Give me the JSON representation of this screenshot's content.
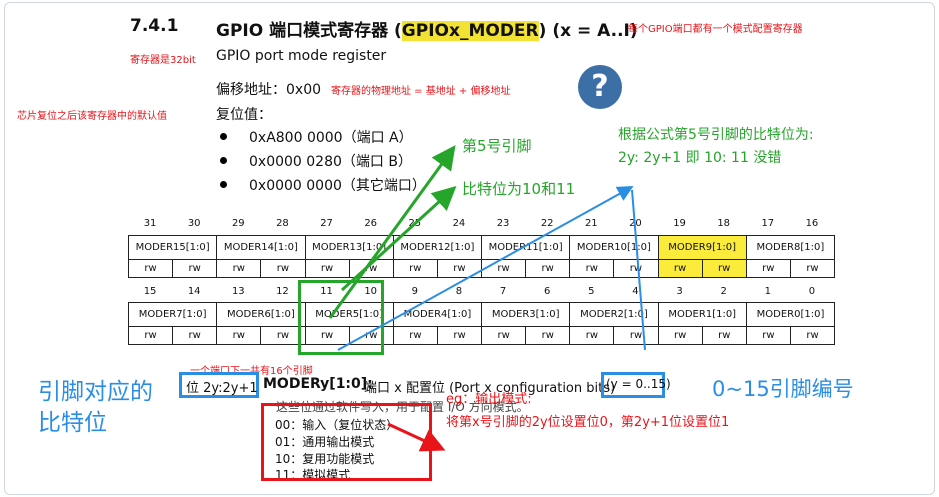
{
  "section": {
    "number": "7.4.1",
    "title_prefix": "GPIO 端口模式寄存器 (",
    "title_reg": "GPIOx_MODER",
    "title_suffix": ") (x = A..I)"
  },
  "annotations": {
    "title_note": "每个GPIO端口都有一个模式配置寄存器",
    "bits_note": "寄存器是32bit",
    "addr_note": "寄存器的物理地址 = 基地址 + 偏移地址",
    "reset_note": "芯片复位之后该寄存器中的默认值",
    "pin5": "第5号引脚",
    "bits_10_11": "比特位为10和11",
    "formula_line1": "根据公式第5号引脚的比特位为:",
    "formula_line2": "2y: 2y+1 即 10: 11 没错",
    "per_port": "一个端口下一共有16个引脚",
    "pin_bits_line1": "引脚对应的",
    "pin_bits_line2": "比特位",
    "pin_numbers": "0~15引脚编号",
    "eg": "eg：输出模式:",
    "eg_detail": "将第x号引脚的2y位设置位0，第2y+1位设置位1"
  },
  "doc": {
    "desc": "GPIO port mode register",
    "offset_label": "偏移地址：",
    "offset_value": "0x00",
    "reset_label": "复位值：",
    "reset_values": [
      "0xA800 0000（端口 A）",
      "0x0000 0280（端口 B）",
      "0x0000 0000（其它端口）"
    ],
    "field_bits": "位 2y:2y+1",
    "field_name": "MODERy[1:0]:",
    "field_desc": "端口 x 配置位 (Port x configuration bits)",
    "field_range": "(y = 0..15)",
    "field_sub": "这些位通过软件写入，用于配置 I/O 方向模式。",
    "modes": [
      "00：输入（复位状态）",
      "01：通用输出模式",
      "10：复用功能模式",
      "11：模拟模式"
    ]
  },
  "register": {
    "high_bits": [
      "31",
      "30",
      "29",
      "28",
      "27",
      "26",
      "25",
      "24",
      "23",
      "22",
      "21",
      "20",
      "19",
      "18",
      "17",
      "16"
    ],
    "low_bits": [
      "15",
      "14",
      "13",
      "12",
      "11",
      "10",
      "9",
      "8",
      "7",
      "6",
      "5",
      "4",
      "3",
      "2",
      "1",
      "0"
    ],
    "high_fields": [
      "MODER15[1:0]",
      "MODER14[1:0]",
      "MODER13[1:0]",
      "MODER12[1:0]",
      "MODER11[1:0]",
      "MODER10[1:0]",
      "MODER9[1:0]",
      "MODER8[1:0]"
    ],
    "low_fields": [
      "MODER7[1:0]",
      "MODER6[1:0]",
      "MODER5[1:0]",
      "MODER4[1:0]",
      "MODER3[1:0]",
      "MODER2[1:0]",
      "MODER1[1:0]",
      "MODER0[1:0]"
    ],
    "access": "rw"
  },
  "icons": {
    "help": "?"
  },
  "colors": {
    "red": "#e8141a",
    "green": "#25a52a",
    "blue": "#2a8ee6",
    "highlight": "#fbeb3a"
  }
}
